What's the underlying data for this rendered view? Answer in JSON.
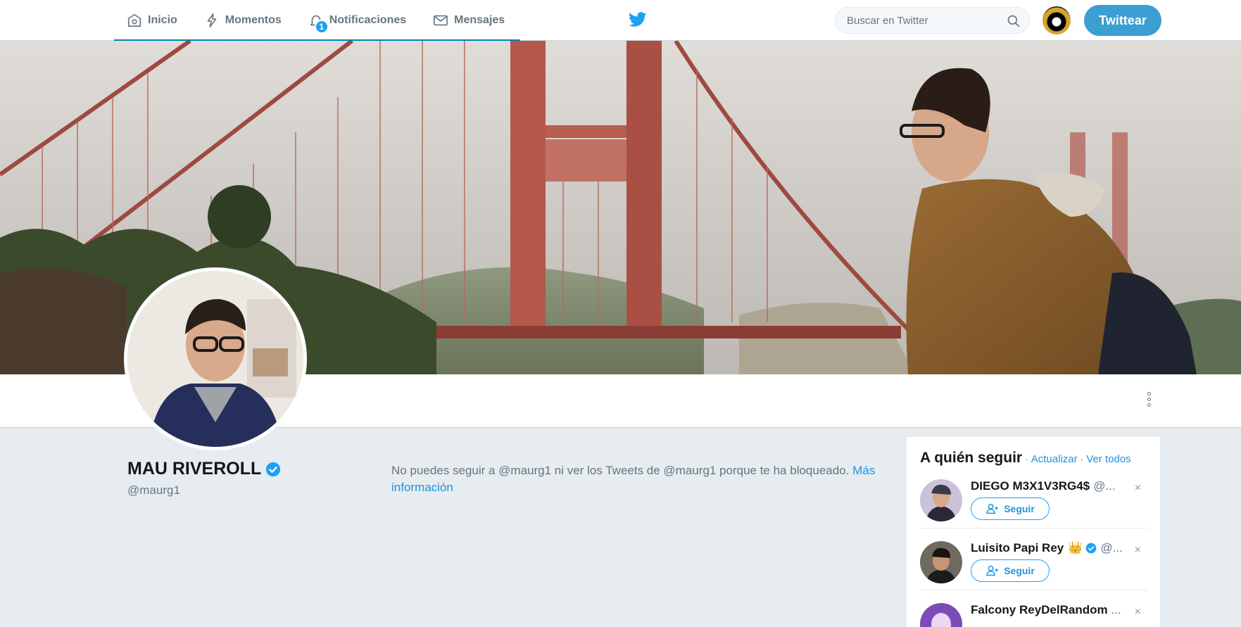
{
  "nav": {
    "items": [
      {
        "label": "Inicio",
        "icon": "home-icon"
      },
      {
        "label": "Momentos",
        "icon": "lightning-icon"
      },
      {
        "label": "Notificaciones",
        "icon": "bell-icon",
        "badge": "1"
      },
      {
        "label": "Mensajes",
        "icon": "envelope-icon"
      }
    ],
    "search_placeholder": "Buscar en Twitter",
    "tweet_button": "Twittear"
  },
  "profile": {
    "name": "MAU RIVEROLL",
    "handle": "@maurg1",
    "verified": true
  },
  "blocked": {
    "message": "No puedes seguir a @maurg1 ni ver los Tweets de @maurg1 porque te ha bloqueado.",
    "link": "Más información"
  },
  "who_to_follow": {
    "title": "A quién seguir",
    "separator": "·",
    "refresh": "Actualizar",
    "view_all": "Ver todos",
    "follow_label": "Seguir",
    "dismiss": "×",
    "accounts": [
      {
        "name": "DIEGO M3X1V3RG4$",
        "handle": "@..."
      },
      {
        "name": "Luisito Papi Rey",
        "emoji": "👑",
        "handle": "@..."
      },
      {
        "name": "Falcony ReyDelRandom",
        "handle": "..."
      }
    ]
  },
  "colors": {
    "accent": "#1da1f2",
    "link": "#1b95e0",
    "tweet_button": "#3b9fd1",
    "background": "#e6ecf0"
  }
}
